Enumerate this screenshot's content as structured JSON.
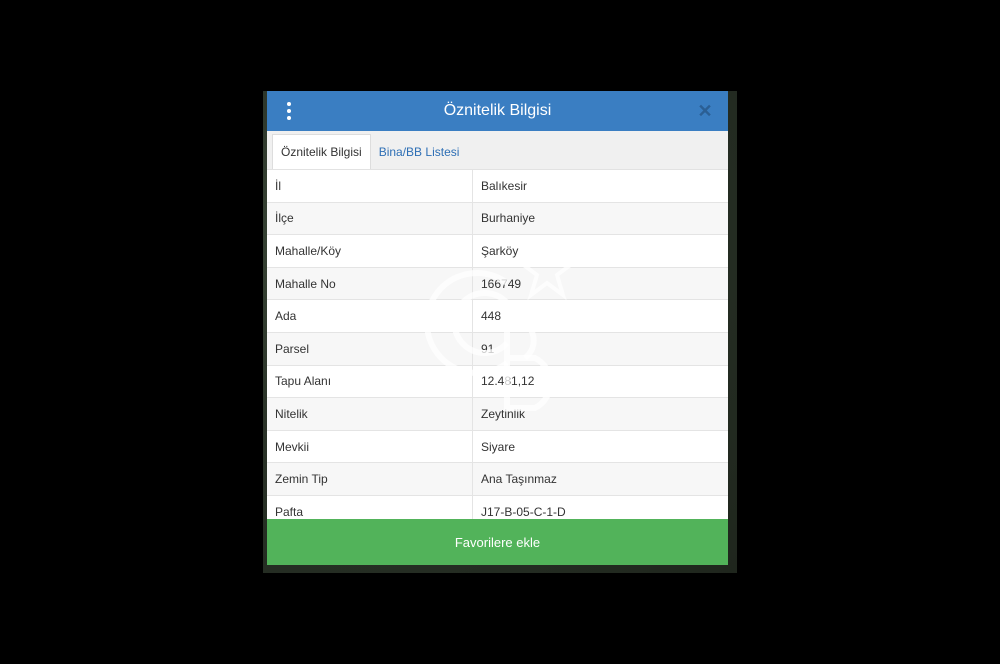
{
  "dialog": {
    "title": "Öznitelik Bilgisi",
    "close_symbol": "✕",
    "icons": [
      "menu-dots-icon",
      "close-icon"
    ]
  },
  "tabs": [
    {
      "label": "Öznitelik Bilgisi",
      "active": true
    },
    {
      "label": "Bina/BB Listesi",
      "active": false
    }
  ],
  "rows": [
    {
      "key": "İl",
      "value": "Balıkesir"
    },
    {
      "key": "İlçe",
      "value": "Burhaniye"
    },
    {
      "key": "Mahalle/Köy",
      "value": "Şarköy"
    },
    {
      "key": "Mahalle No",
      "value": "166749"
    },
    {
      "key": "Ada",
      "value": "448"
    },
    {
      "key": "Parsel",
      "value": "91"
    },
    {
      "key": "Tapu Alanı",
      "value": "12.481,12"
    },
    {
      "key": "Nitelik",
      "value": "Zeytinlik"
    },
    {
      "key": "Mevkii",
      "value": "Siyare"
    },
    {
      "key": "Zemin Tip",
      "value": "Ana Taşınmaz"
    },
    {
      "key": "Pafta",
      "value": "J17-B-05-C-1-D"
    }
  ],
  "footer": {
    "favorite_label": "Favorilere ekle"
  },
  "colors": {
    "header": "#3a7ec2",
    "favorite_button": "#52b35a",
    "tab_link": "#2e6fb5"
  }
}
